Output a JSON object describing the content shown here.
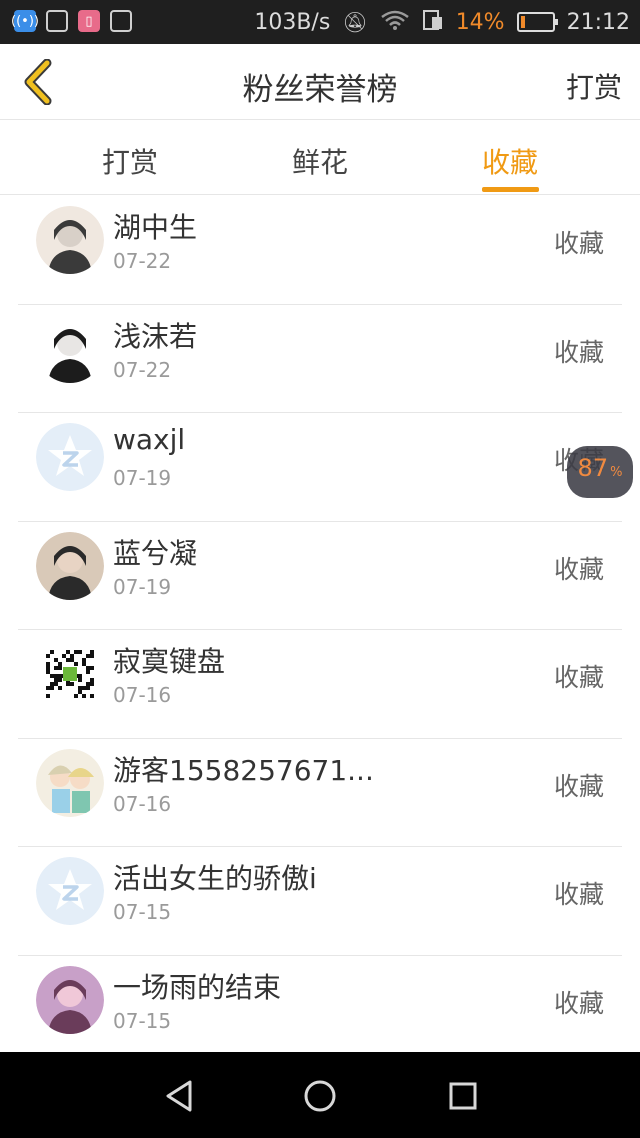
{
  "status_bar": {
    "net_speed": "103B/s",
    "battery_pct": "14%",
    "battery_level": 0.14,
    "time": "21:12",
    "icons": [
      "wifi-app-icon",
      "mail-icon",
      "notification-icon",
      "image-icon",
      "mute-icon",
      "wifi-icon",
      "sim-icon",
      "battery-icon"
    ]
  },
  "header": {
    "title": "粉丝荣誉榜",
    "action": "打赏"
  },
  "tabs": [
    {
      "label": "打赏",
      "active": false
    },
    {
      "label": "鲜花",
      "active": false
    },
    {
      "label": "收藏",
      "active": true
    }
  ],
  "list": [
    {
      "name": "湖中生",
      "date": "07-22",
      "action": "收藏",
      "avatar": "photo"
    },
    {
      "name": "浅沫若",
      "date": "07-22",
      "action": "收藏",
      "avatar": "photo"
    },
    {
      "name": "waxjl",
      "date": "07-19",
      "action": "收藏",
      "avatar": "default"
    },
    {
      "name": "蓝兮凝",
      "date": "07-19",
      "action": "收藏",
      "avatar": "photo"
    },
    {
      "name": "寂寞键盘",
      "date": "07-16",
      "action": "收藏",
      "avatar": "qr"
    },
    {
      "name": "游客1558257671...",
      "date": "07-16",
      "action": "收藏",
      "avatar": "anime"
    },
    {
      "name": "活出女生的骄傲i",
      "date": "07-15",
      "action": "收藏",
      "avatar": "default"
    },
    {
      "name": "一场雨的结束",
      "date": "07-15",
      "action": "收藏",
      "avatar": "photo"
    }
  ],
  "float_badge": {
    "value": "87",
    "unit": "%"
  },
  "colors": {
    "accent": "#f09a14",
    "text": "#333333",
    "muted": "#9a9a9a"
  }
}
